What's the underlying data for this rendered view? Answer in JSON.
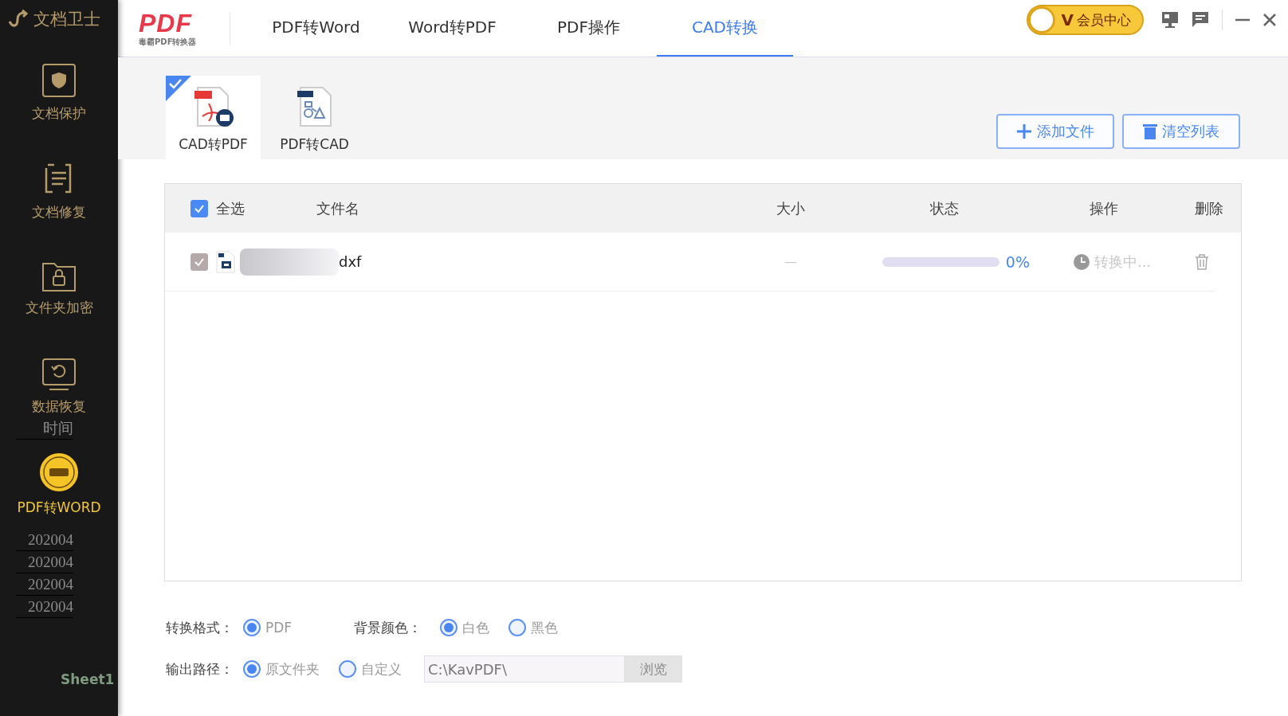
{
  "overlay_app": {
    "title": "文档卫士",
    "items": [
      {
        "label": "文档保护",
        "kind": "shield",
        "highlighted": false
      },
      {
        "label": "文档修复",
        "kind": "repair",
        "highlighted": false
      },
      {
        "label": "文件夹加密",
        "kind": "lock",
        "highlighted": false
      },
      {
        "label": "数据恢复",
        "kind": "restore",
        "highlighted": false
      },
      {
        "label": "PDF转WORD",
        "kind": "pdf",
        "highlighted": true
      }
    ]
  },
  "sheet": {
    "header": "时间",
    "rows": [
      "202004",
      "202004",
      "202004",
      "202004"
    ],
    "tab": "Sheet1"
  },
  "app": {
    "logo": "PDF",
    "logo_subtitle": "毒霸PDF转换器",
    "nav": [
      {
        "label": "PDF转Word",
        "selected": false
      },
      {
        "label": "Word转PDF",
        "selected": false
      },
      {
        "label": "PDF操作",
        "selected": false
      },
      {
        "label": "CAD转换",
        "selected": true
      }
    ],
    "member_badge": "V",
    "member": "会员中心"
  },
  "modes": [
    {
      "label": "CAD转PDF",
      "kind": "cad2pdf",
      "selected": true
    },
    {
      "label": "PDF转CAD",
      "kind": "pdf2cad",
      "selected": false
    }
  ],
  "buttons": [
    {
      "label": "添加文件",
      "kind": "add"
    },
    {
      "label": "清空列表",
      "kind": "clear"
    }
  ],
  "table": {
    "select_all": {
      "label": "全选",
      "checked": true
    },
    "columns": [
      "文件名",
      "大小",
      "状态",
      "操作",
      "删除"
    ],
    "rows": [
      {
        "checked": true,
        "disabled": true,
        "name": "dxf",
        "size": "—",
        "level": 0,
        "progress": "0%",
        "action": "转换中..."
      }
    ]
  },
  "options": {
    "format": {
      "label": "转换格式：",
      "choices": [
        {
          "label": "PDF",
          "selected": true
        }
      ]
    },
    "background": {
      "label": "背景颜色：",
      "choices": [
        {
          "label": "白色",
          "selected": true
        },
        {
          "label": "黑色",
          "selected": false
        }
      ]
    },
    "output": {
      "label": "输出路径：",
      "choices": [
        {
          "label": "原文件夹",
          "selected": true
        },
        {
          "label": "自定义",
          "selected": false
        }
      ],
      "path": "C:\\KavPDF\\",
      "browse": "浏览",
      "browse_disabled": true
    }
  }
}
